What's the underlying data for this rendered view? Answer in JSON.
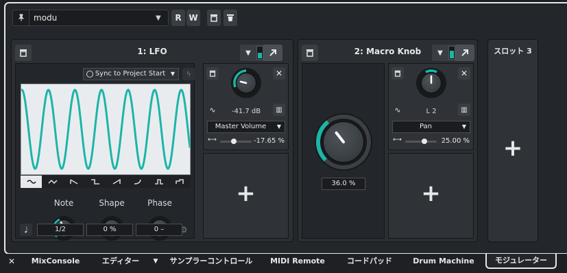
{
  "header": {
    "preset_value": "modu",
    "read_label": "R",
    "write_label": "W"
  },
  "lfo": {
    "title": "1: LFO",
    "sync_label": "Sync to Project Start",
    "shapes": [
      "sine",
      "triangle",
      "ramp-down",
      "square",
      "ramp-up",
      "curve",
      "pulse",
      "step"
    ],
    "selected_shape": 0,
    "knobs": [
      {
        "label": "Note",
        "value": "1/2"
      },
      {
        "label": "Shape",
        "value": "0 %"
      },
      {
        "label": "Phase",
        "value": "0 –"
      }
    ],
    "target": {
      "readout": "-41.7 dB",
      "parameter": "Master Volume",
      "range_value": "-17.65 %"
    }
  },
  "macro": {
    "title": "2: Macro Knob",
    "big_value": "36.0 %",
    "big_level": 0.36,
    "target": {
      "readout": "L 2",
      "parameter": "Pan",
      "range_value": "25.00 %"
    }
  },
  "slot3": {
    "title": "スロット 3"
  },
  "colors": {
    "accent": "#1ab5a8",
    "panel": "#2b2e33",
    "background": "#1e2023"
  },
  "tabs": [
    {
      "label": "MixConsole"
    },
    {
      "label": "エディター"
    },
    {
      "label": "サンプラーコントロール"
    },
    {
      "label": "MIDI Remote"
    },
    {
      "label": "コードパッド"
    },
    {
      "label": "Drum Machine"
    },
    {
      "label": "モジュレーター"
    }
  ]
}
